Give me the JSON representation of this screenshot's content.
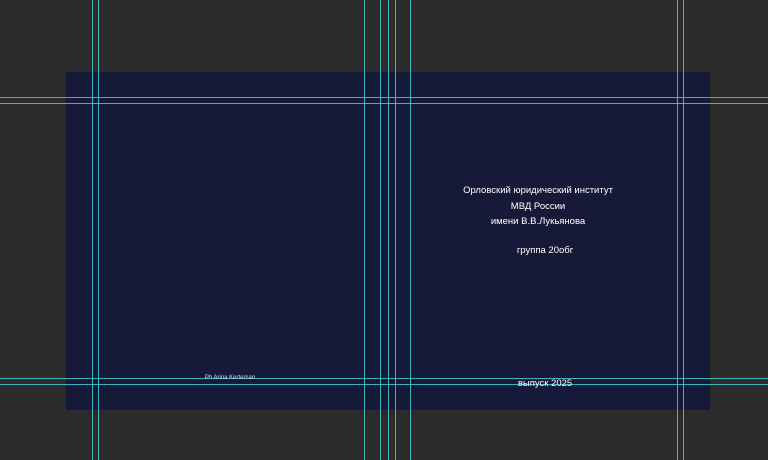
{
  "cover": {
    "back_credit": "Ph Arina Kerteman",
    "title_lines": [
      "Орловский юридический институт",
      "МВД России",
      "имени В.В.Лукьянова"
    ],
    "group": "группа 20обг",
    "issue": "выпуск 2025"
  },
  "colors": {
    "workspace": "#2b2b2b",
    "page": "#171938",
    "guide": "#3fd0d6",
    "text": "#ffffff"
  }
}
